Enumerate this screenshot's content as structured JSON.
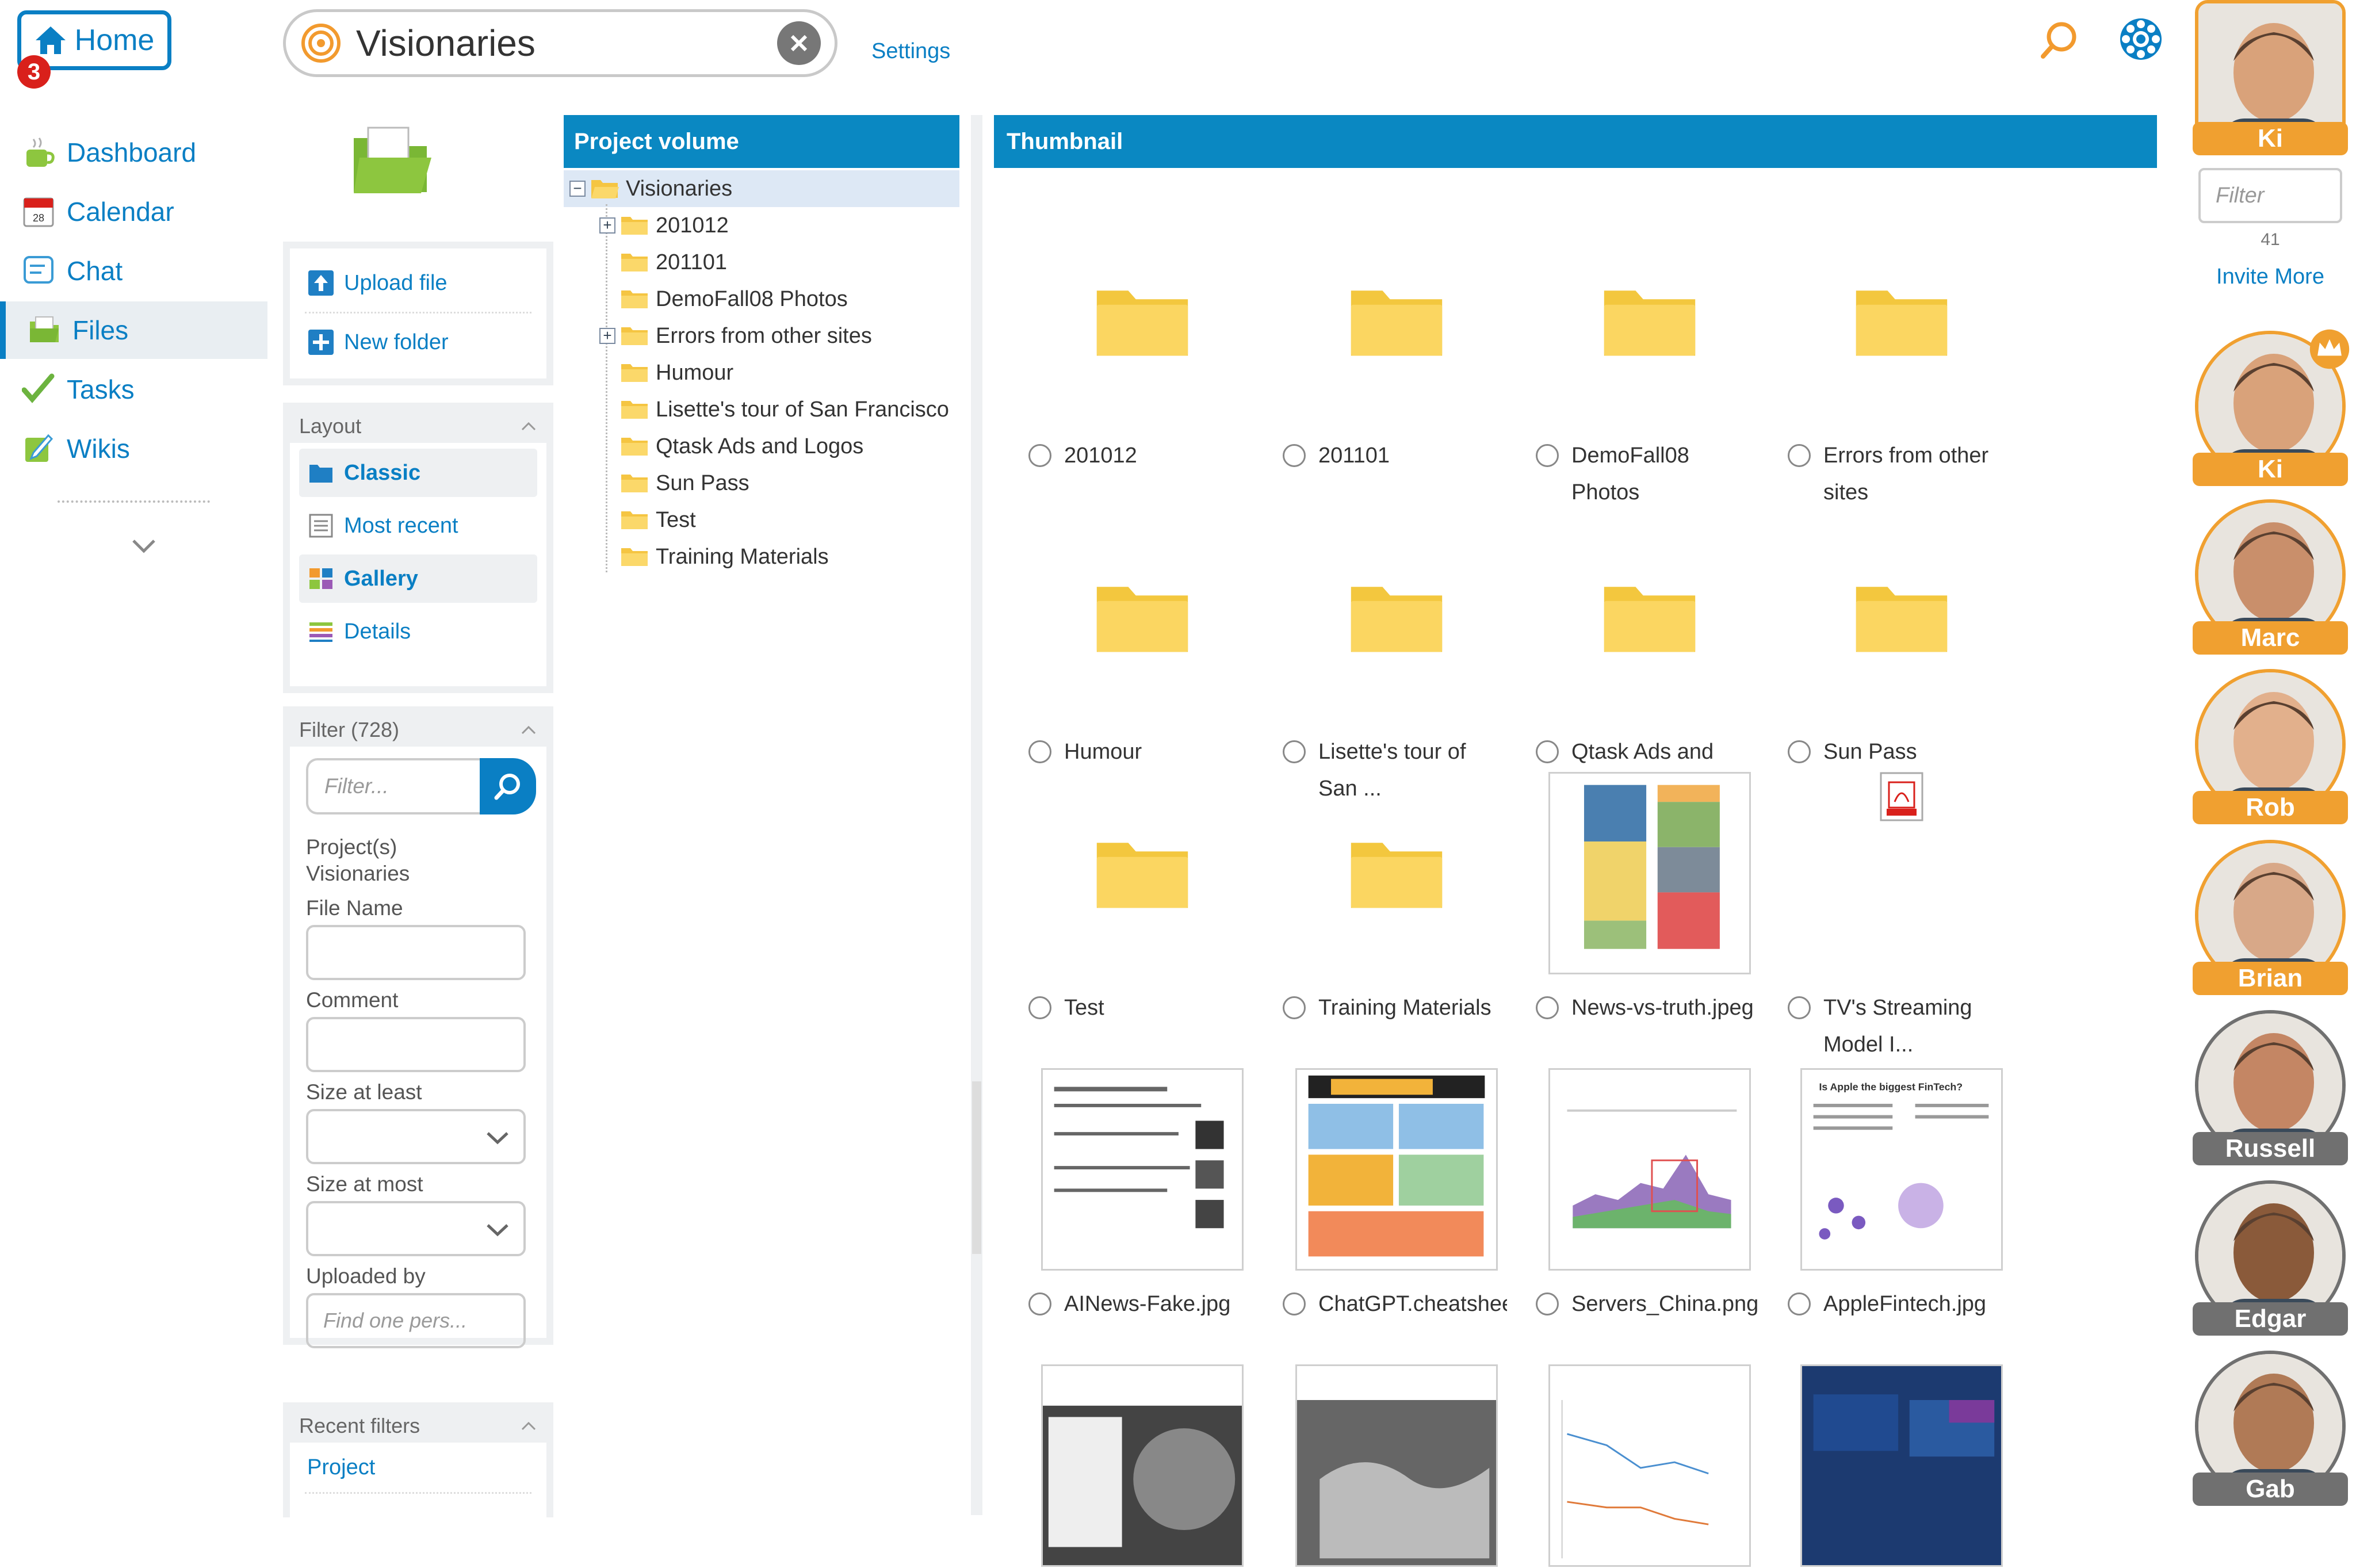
{
  "home": {
    "label": "Home",
    "badge": "3"
  },
  "nav": [
    {
      "label": "Dashboard",
      "icon": "dashboard-icon"
    },
    {
      "label": "Calendar",
      "icon": "calendar-icon"
    },
    {
      "label": "Chat",
      "icon": "chat-icon"
    },
    {
      "label": "Files",
      "icon": "files-icon"
    },
    {
      "label": "Tasks",
      "icon": "tasks-icon"
    },
    {
      "label": "Wikis",
      "icon": "wikis-icon"
    }
  ],
  "search": {
    "value": "Visionaries"
  },
  "settings_label": "Settings",
  "actions": {
    "upload": "Upload file",
    "new_folder": "New folder"
  },
  "layout": {
    "title": "Layout",
    "classic": "Classic",
    "most_recent": "Most recent",
    "gallery": "Gallery",
    "details": "Details"
  },
  "filter": {
    "title": "Filter (728)",
    "placeholder": "Filter...",
    "projects_label": "Project(s)",
    "projects_value": "Visionaries",
    "file_name": "File Name",
    "comment": "Comment",
    "size_least": "Size at least",
    "size_most": "Size at most",
    "uploaded_by": "Uploaded by",
    "uploaded_placeholder": "Find one pers..."
  },
  "recent_filters": {
    "title": "Recent filters",
    "item": "Project"
  },
  "tree": {
    "header": "Project volume",
    "root": "Visionaries",
    "items": [
      {
        "label": "201012",
        "expandable": true
      },
      {
        "label": "201101",
        "expandable": false
      },
      {
        "label": "DemoFall08 Photos",
        "expandable": false
      },
      {
        "label": "Errors from other sites",
        "expandable": true
      },
      {
        "label": "Humour",
        "expandable": false
      },
      {
        "label": "Lisette's tour of San Francisco",
        "expandable": false
      },
      {
        "label": "Qtask Ads and Logos",
        "expandable": false
      },
      {
        "label": "Sun Pass",
        "expandable": false
      },
      {
        "label": "Test",
        "expandable": false
      },
      {
        "label": "Training Materials",
        "expandable": false
      }
    ]
  },
  "thumb_header": "Thumbnail",
  "thumbs": [
    {
      "name": "201012",
      "kind": "folder"
    },
    {
      "name": "201101",
      "kind": "folder"
    },
    {
      "name": "DemoFall08 Photos",
      "kind": "folder"
    },
    {
      "name": "Errors from other sites",
      "kind": "folder"
    },
    {
      "name": "Humour",
      "kind": "folder"
    },
    {
      "name": "Lisette's tour of San ...",
      "kind": "folder"
    },
    {
      "name": "Qtask Ads and Logos",
      "kind": "folder"
    },
    {
      "name": "Sun Pass",
      "kind": "folder"
    },
    {
      "name": "Test",
      "kind": "folder"
    },
    {
      "name": "Training Materials",
      "kind": "folder"
    },
    {
      "name": "News-vs-truth.jpeg",
      "kind": "image"
    },
    {
      "name": "TV's Streaming Model I...",
      "kind": "pdf"
    },
    {
      "name": "AINews-Fake.jpg",
      "kind": "image"
    },
    {
      "name": "ChatGPT.cheatshee",
      "kind": "image"
    },
    {
      "name": "Servers_China.png",
      "kind": "image"
    },
    {
      "name": "AppleFintech.jpg",
      "kind": "image"
    },
    {
      "name": "",
      "kind": "image"
    },
    {
      "name": "",
      "kind": "image"
    },
    {
      "name": "",
      "kind": "image"
    },
    {
      "name": "",
      "kind": "image"
    }
  ],
  "people": {
    "filter_placeholder": "Filter",
    "count": "41",
    "invite": "Invite More",
    "members": [
      {
        "name": "Ki",
        "color": "#f0a030"
      },
      {
        "name": "Ki",
        "color": "#f0a030"
      },
      {
        "name": "Marc",
        "color": "#f0a030"
      },
      {
        "name": "Rob",
        "color": "#f0a030"
      },
      {
        "name": "Brian",
        "color": "#f0a030"
      },
      {
        "name": "Russell",
        "color": "#707070"
      },
      {
        "name": "Edgar",
        "color": "#707070"
      },
      {
        "name": "Gab",
        "color": "#707070"
      }
    ]
  }
}
